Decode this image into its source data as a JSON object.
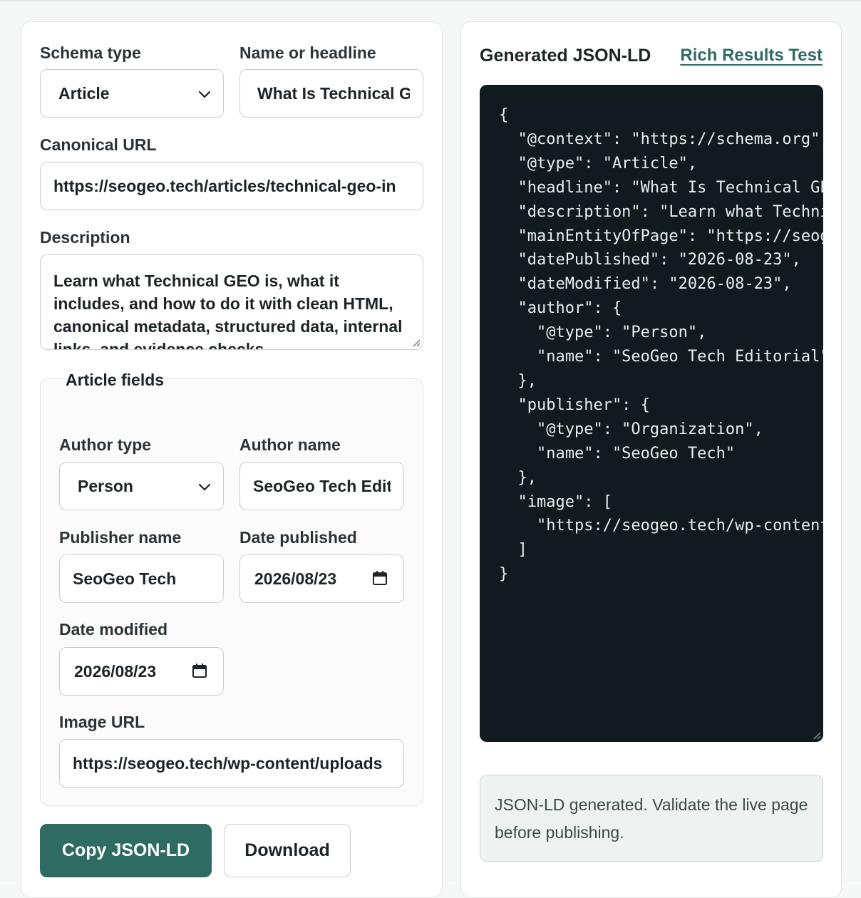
{
  "form": {
    "schema_type": {
      "label": "Schema type",
      "value": "Article"
    },
    "headline": {
      "label": "Name or headline",
      "value": "What Is Technical GEO"
    },
    "canonical_url": {
      "label": "Canonical URL",
      "value": "https://seogeo.tech/articles/technical-geo-in"
    },
    "description": {
      "label": "Description",
      "value": "Learn what Technical GEO is, what it includes, and how to do it with clean HTML, canonical metadata, structured data, internal links, and evidence checks."
    },
    "article_fields": {
      "legend": "Article fields",
      "author_type": {
        "label": "Author type",
        "value": "Person"
      },
      "author_name": {
        "label": "Author name",
        "value": "SeoGeo Tech Editorial"
      },
      "publisher_name": {
        "label": "Publisher name",
        "value": "SeoGeo Tech"
      },
      "date_published": {
        "label": "Date published",
        "value": "2026/08/23"
      },
      "date_modified": {
        "label": "Date modified",
        "value": "2026/08/23"
      },
      "image_url": {
        "label": "Image URL",
        "value": "https://seogeo.tech/wp-content/uploads"
      }
    },
    "copy_label": "Copy JSON-LD",
    "download_label": "Download"
  },
  "output": {
    "title": "Generated JSON-LD",
    "rich_results_link": "Rich Results Test",
    "json_text": "{\n  \"@context\": \"https://schema.org\",\n  \"@type\": \"Article\",\n  \"headline\": \"What Is Technical GEO\",\n  \"description\": \"Learn what Technical GEO is\",\n  \"mainEntityOfPage\": \"https://seogeo.tech\",\n  \"datePublished\": \"2026-08-23\",\n  \"dateModified\": \"2026-08-23\",\n  \"author\": {\n    \"@type\": \"Person\",\n    \"name\": \"SeoGeo Tech Editorial\"\n  },\n  \"publisher\": {\n    \"@type\": \"Organization\",\n    \"name\": \"SeoGeo Tech\"\n  },\n  \"image\": [\n    \"https://seogeo.tech/wp-content/uploads\"\n  ]\n}",
    "status": "JSON-LD generated. Validate the live page before publishing."
  },
  "colors": {
    "accent": "#2e6b63",
    "code_bg": "#111a1f",
    "status_bg": "#eef3f1"
  },
  "icons": [
    "chevron-down-icon",
    "calendar-icon",
    "resize-grip-icon"
  ]
}
